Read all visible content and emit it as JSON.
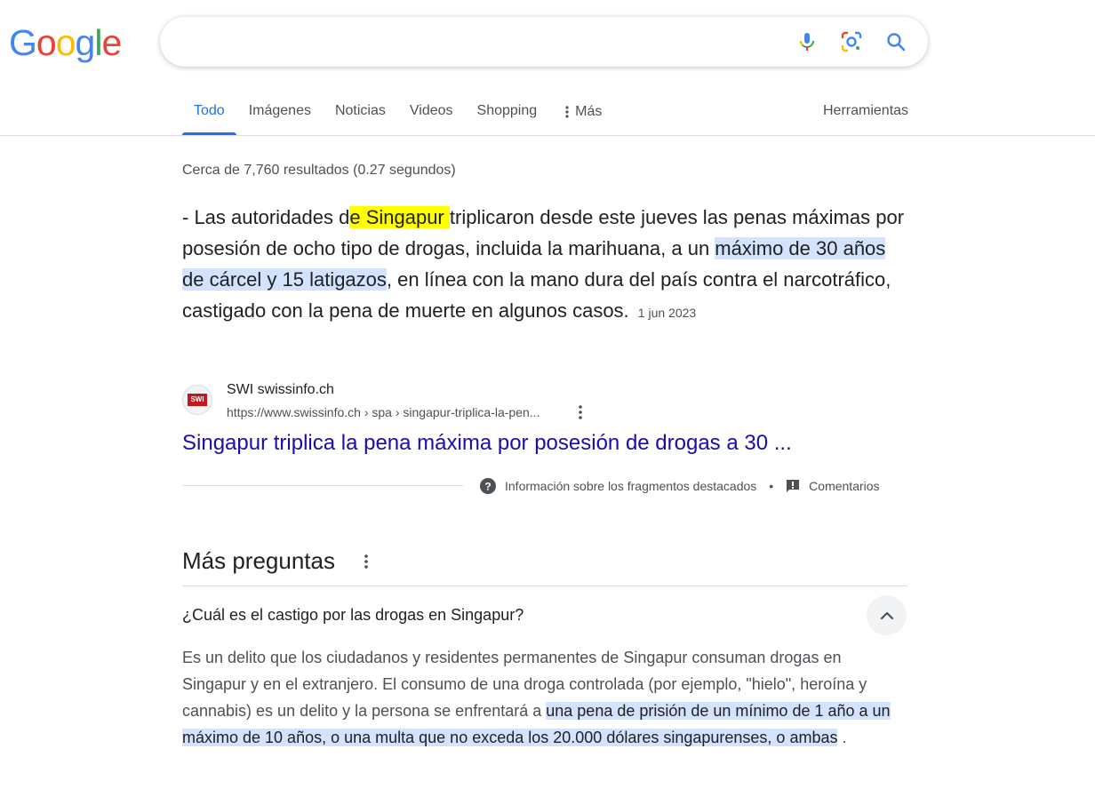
{
  "logo": {
    "text": "Google",
    "letters": [
      {
        "c": "G",
        "color": "#4285F4"
      },
      {
        "c": "o",
        "color": "#EA4335"
      },
      {
        "c": "o",
        "color": "#FBBC05"
      },
      {
        "c": "g",
        "color": "#4285F4"
      },
      {
        "c": "l",
        "color": "#34A853"
      },
      {
        "c": "e",
        "color": "#EA4335"
      }
    ]
  },
  "search": {
    "value": "",
    "icons": [
      "mic-icon",
      "lens-icon",
      "search-icon"
    ]
  },
  "tabs": {
    "todo": "Todo",
    "imagenes": "Imágenes",
    "noticias": "Noticias",
    "videos": "Videos",
    "shopping": "Shopping",
    "mas": "Más",
    "herramientas": "Herramientas"
  },
  "result_stats": "Cerca de 7,760 resultados (0.27 segundos)",
  "snippet": {
    "p1": "- Las autoridades d",
    "hl1": "e Singapur ",
    "p2": "triplicaron desde este jueves las penas máximas por posesión de ocho tipo de drogas, incluida la marihuana, a un ",
    "hl2": "máximo de 30 años de cárcel y 15 latigazos",
    "p3": ", en línea con la mano dura del país contra el narcotráfico, castigado con la pena de muerte en algunos casos.",
    "date": "1 jun 2023"
  },
  "source": {
    "badge": "SWI",
    "name": "SWI swissinfo.ch",
    "url": "https://www.swissinfo.ch › spa › singapur-triplica-la-pen...",
    "title": "Singapur triplica la pena máxima por posesión de drogas a 30 ..."
  },
  "feedback": {
    "about": "Información sobre los fragmentos destacados",
    "separator": "•",
    "comments": "Comentarios"
  },
  "paa": {
    "title": "Más preguntas",
    "question": "¿Cuál es el castigo por las drogas en Singapur?",
    "answer_p1": "Es un delito que los ciudadanos y residentes permanentes de Singapur consuman drogas en Singapur y en el extranjero. El consumo de una droga controlada (por ejemplo, \"hielo\", heroína y cannabis) es un delito y la persona se enfrentará a ",
    "answer_hl": "una pena de prisión de un mínimo de 1 año a un máximo de 10 años, o una multa que no exceda los 20.000 dólares singapurenses, o ambas",
    "answer_p2": " ."
  },
  "colors": {
    "link": "#1a0dab",
    "accent": "#1a73e8",
    "highlight_blue": "#d3e3fd",
    "highlight_yellow": "#ffff00"
  }
}
